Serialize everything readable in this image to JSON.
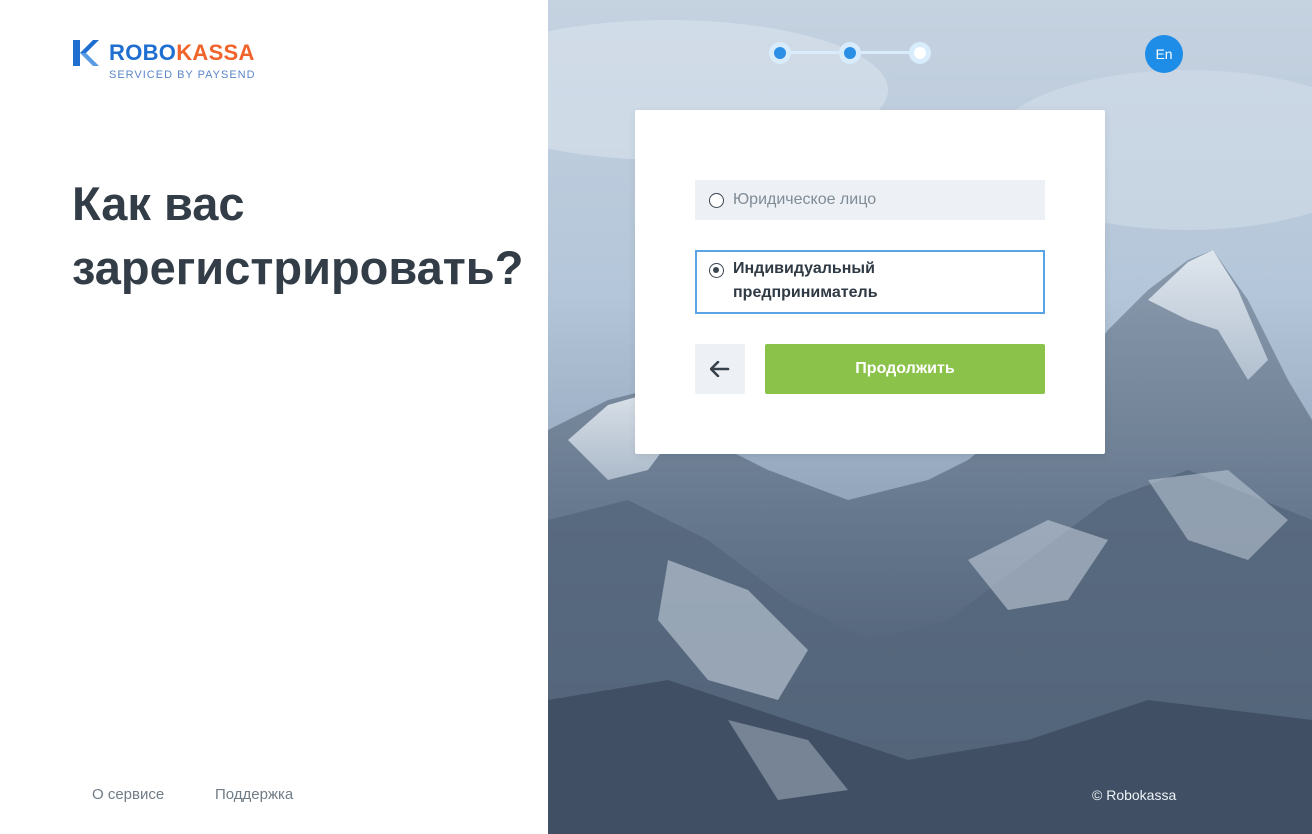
{
  "brand": {
    "name_part1": "ROBO",
    "name_part2": "KASSA",
    "tagline": "SERVICED BY PAYSEND",
    "color_primary": "#1f6fd1",
    "color_accent": "#f0632a"
  },
  "page": {
    "title": "Как вас зарегистрировать?"
  },
  "progress": {
    "total_steps": 3,
    "current_step": 3
  },
  "language_button": {
    "label": "En"
  },
  "form": {
    "options": [
      {
        "label": "Юридическое лицо",
        "selected": false
      },
      {
        "label": "Индивидуальный предприниматель",
        "selected": true
      }
    ],
    "back_icon": "arrow-left-icon",
    "continue_label": "Продолжить",
    "continue_color": "#8bc34a"
  },
  "footer": {
    "links": [
      "О сервисе",
      "Поддержка"
    ],
    "copyright": "© Robokassa"
  }
}
